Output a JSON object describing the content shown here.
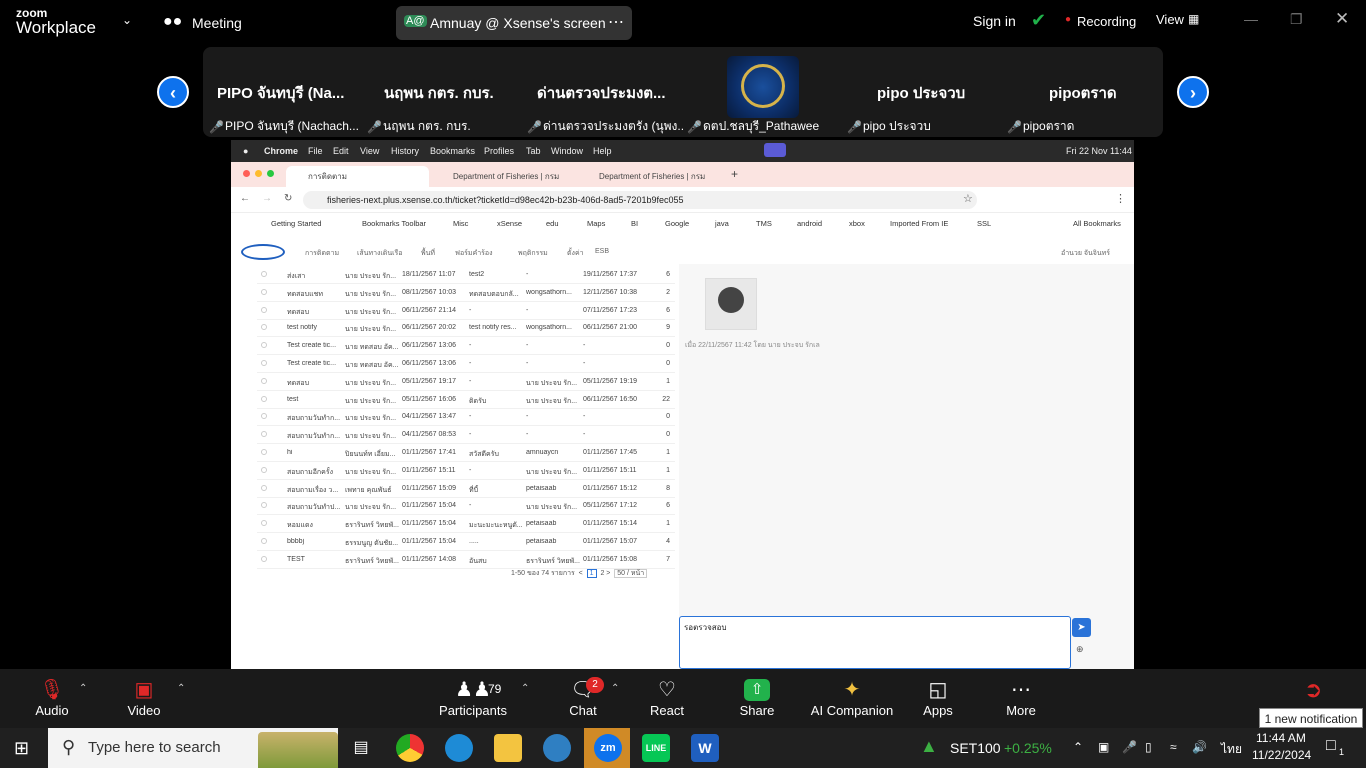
{
  "window": {
    "logo_small": "zoom",
    "logo_big": "Workplace",
    "meeting_label": "Meeting",
    "screen_title": "Amnuay @ Xsense's screen",
    "screen_initials": "A@",
    "sign_in": "Sign in",
    "recording": "Recording",
    "view": "View",
    "colors": {
      "accent": "#0e72ed",
      "recording": "#e02828",
      "shield": "#20b14a"
    }
  },
  "gallery": {
    "tiles": [
      {
        "name": "PIPO จันทบุรี (Na...",
        "caption": "PIPO จันทบุรี (Nachach..."
      },
      {
        "name": "นฤพน  กตร. กบร.",
        "caption": "นฤพน  กตร. กบร."
      },
      {
        "name": "ด่านตรวจประมงต...",
        "caption": "ด่านตรวจประมงตรัง (นุพง..."
      },
      {
        "name": "",
        "caption": "ดตป.ชลบุรี_Pathawee"
      },
      {
        "name": "pipo ประจวบ",
        "caption": "pipo ประจวบ"
      },
      {
        "name": "pipoตราด",
        "caption": "pipoตราด"
      }
    ]
  },
  "shared": {
    "mac_menu": [
      "Chrome",
      "File",
      "Edit",
      "View",
      "History",
      "Bookmarks",
      "Profiles",
      "Tab",
      "Window",
      "Help"
    ],
    "clock": "Fri 22 Nov  11:44",
    "tabs": [
      "การติดตาม",
      "Department of Fisheries | กรม",
      "Department of Fisheries | กรม"
    ],
    "url": "fisheries-next.plus.xsense.co.th/ticket?ticketId=d98ec42b-b23b-406d-8ad5-7201b9fec055",
    "bookmarks": [
      "Getting Started",
      "Bookmarks Toolbar",
      "Misc",
      "xSense",
      "edu",
      "Maps",
      "BI",
      "Google",
      "java",
      "TMS",
      "android",
      "xbox",
      "Imported From IE",
      "SSL",
      "All Bookmarks"
    ],
    "app_nav": [
      "การติดตาม",
      "เส้นทางเดินเรือ",
      "พื้นที่",
      "ฟอร์มคำร้อง",
      "พฤติกรรม",
      "ตั้งค่า",
      "ESB"
    ],
    "user_name": "อำนวย จันจินทร์",
    "rows": [
      [
        "ส่งเสา",
        "นาย ประจบ รัก...",
        "18/11/2567 11:07",
        "test2",
        "-",
        "19/11/2567 17:37",
        "6"
      ],
      [
        "ทดสอบแชท",
        "นาย ประจบ รัก...",
        "08/11/2567 10:03",
        "ทดสอบตอบกลั...",
        "wongsathorn...",
        "12/11/2567 10:38",
        "2"
      ],
      [
        "ทดสอบ",
        "นาย ประจบ รัก...",
        "06/11/2567 21:14",
        "-",
        "-",
        "07/11/2567 17:23",
        "6"
      ],
      [
        "test notify",
        "นาย ประจบ รัก...",
        "06/11/2567 20:02",
        "test notify res...",
        "wongsathorn...",
        "06/11/2567 21:00",
        "9"
      ],
      [
        "Test create tic...",
        "นาย ทดสอบ อัค...",
        "06/11/2567 13:06",
        "-",
        "-",
        "-",
        "0"
      ],
      [
        "Test create tic...",
        "นาย ทดสอบ อัค...",
        "06/11/2567 13:06",
        "-",
        "-",
        "-",
        "0"
      ],
      [
        "ทดสอบ",
        "นาย ประจบ รัก...",
        "05/11/2567 19:17",
        "-",
        "นาย ประจบ รัก...",
        "05/11/2567 19:19",
        "1"
      ],
      [
        "test",
        "นาย ประจบ รัก...",
        "05/11/2567 16:06",
        "ติดรับ",
        "นาย ประจบ รัก...",
        "06/11/2567 16:50",
        "22"
      ],
      [
        "สอบถามวันทำก...",
        "นาย ประจบ รัก...",
        "04/11/2567 13:47",
        "-",
        "-",
        "-",
        "0"
      ],
      [
        "สอบถามวันทำก...",
        "นาย ประจบ รัก...",
        "04/11/2567 08:53",
        "-",
        "-",
        "-",
        "0"
      ],
      [
        "hi",
        "ปิยนนท์ท เอี่ยม...",
        "01/11/2567 17:41",
        "สวัสดีครับ",
        "amnuaycn",
        "01/11/2567 17:45",
        "1"
      ],
      [
        "สอบถามอีกครั้ง",
        "นาย ประจบ รัก...",
        "01/11/2567 15:11",
        "-",
        "นาย ประจบ รัก...",
        "01/11/2567 15:11",
        "1"
      ],
      [
        "สอบถามเรื่อง ว...",
        "เพทาย คุณพันธ์",
        "01/11/2567 15:09",
        "ที่บี้",
        "petaisaab",
        "01/11/2567 15:12",
        "8"
      ],
      [
        "สอบถามวันทำป...",
        "นาย ประจบ รัก...",
        "01/11/2567 15:04",
        "-",
        "นาย ประจบ รัก...",
        "05/11/2567 17:12",
        "6"
      ],
      [
        "หอมแดง",
        "ธรารินทร์ วิทยพั...",
        "01/11/2567 15:04",
        "มะนะมะนะหนูตั...",
        "petaisaab",
        "01/11/2567 15:14",
        "1"
      ],
      [
        "bbbbj",
        "ธรรมนูญ ตันชัย...",
        "01/11/2567 15:04",
        ".....",
        "petaisaab",
        "01/11/2567 15:07",
        "4"
      ],
      [
        "TEST",
        "ธรารินทร์ วิทยพั...",
        "01/11/2567 14:08",
        "อันสบ",
        "ธรารินทร์ วิทยพั...",
        "01/11/2567 15:08",
        "7"
      ]
    ],
    "pager_text": "1-50 ของ 74 รายการ",
    "pages": [
      "1",
      "2"
    ],
    "per_page": "50 / หน้า",
    "image_caption": "เมื่อ 22/11/2567 11:42 โดย นาย ประจบ รักเล",
    "message_input": "รอตรวจสอบ"
  },
  "toolbar": {
    "audio": "Audio",
    "video": "Video",
    "participants": "Participants",
    "participants_count": "79",
    "chat": "Chat",
    "chat_badge": "2",
    "react": "React",
    "share": "Share",
    "ai_companion": "AI Companion",
    "apps": "Apps",
    "more": "More",
    "notification": "1 new notification"
  },
  "taskbar": {
    "search_placeholder": "Type here to search",
    "ticker_name": "SET100",
    "ticker_change": "+0.25%",
    "lang": "ไทย",
    "time": "11:44 AM",
    "date": "11/22/2024",
    "notif_count": "1"
  }
}
